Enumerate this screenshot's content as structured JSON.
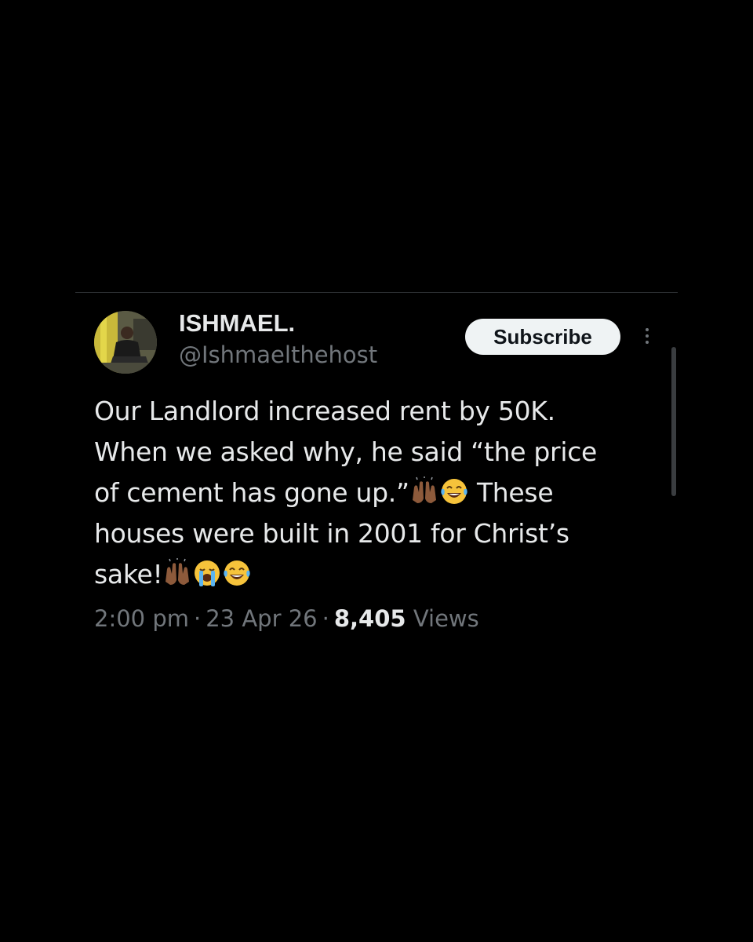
{
  "tweet": {
    "author": {
      "display_name": "ISHMAEL.",
      "handle": "@Ishmaelthehost",
      "avatar_icon": "profile-photo"
    },
    "subscribe_label": "Subscribe",
    "more_icon": "more-vertical-icon",
    "text_lines": [
      "Our Landlord increased rent by 50K.",
      "When we asked why, he said “the price",
      "of cement has gone up.”",
      "These",
      "houses were built in 2001 for Christ’s",
      "sake!"
    ],
    "emojis": [
      "raising-hands-emoji",
      "tears-of-joy-emoji",
      "loudly-crying-emoji"
    ],
    "time": "2:00 pm",
    "date": "23 Apr 26",
    "views_count": "8,405",
    "views_label": "Views",
    "separator": "·"
  },
  "colors": {
    "background": "#000000",
    "primary_text": "#e7e9ea",
    "secondary_text": "#71767b",
    "button_bg": "#eff3f4",
    "button_text": "#0f1419",
    "divider": "#2f3336"
  }
}
